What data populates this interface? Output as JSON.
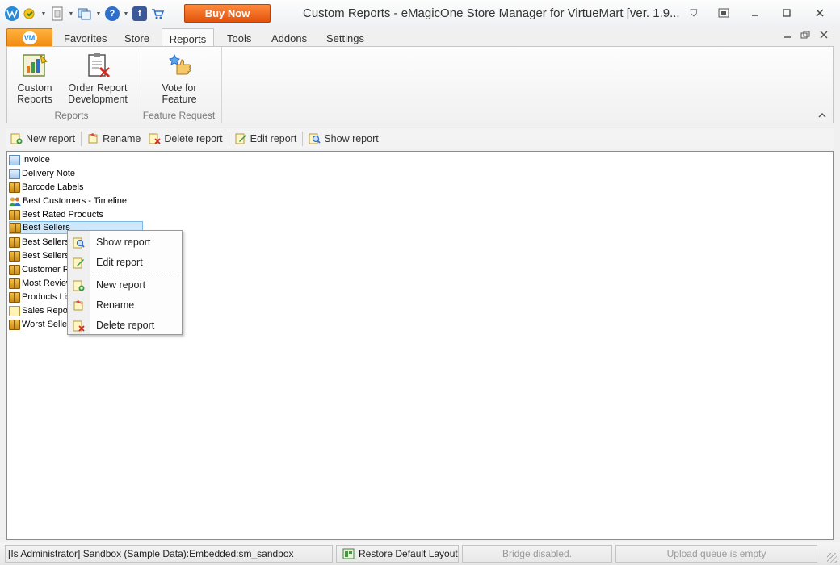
{
  "window": {
    "title": "Custom Reports - eMagicOne Store Manager for VirtueMart [ver. 1.9...",
    "buy_now_label": "Buy Now"
  },
  "ribbon": {
    "app_tab_label": "VM",
    "tabs": [
      "Favorites",
      "Store",
      "Reports",
      "Tools",
      "Addons",
      "Settings"
    ],
    "active_tab": "Reports",
    "groups": [
      {
        "label": "Reports",
        "buttons": [
          {
            "line1": "Custom",
            "line2": "Reports"
          },
          {
            "line1": "Order Report",
            "line2": "Development"
          }
        ]
      },
      {
        "label": "Feature Request",
        "buttons": [
          {
            "line1": "Vote for",
            "line2": "Feature"
          }
        ]
      }
    ]
  },
  "toolbar": {
    "new_report": "New report",
    "rename": "Rename",
    "delete_report": "Delete report",
    "edit_report": "Edit report",
    "show_report": "Show report"
  },
  "reports": [
    {
      "label": "Invoice",
      "icon": "envelope-icon"
    },
    {
      "label": "Delivery Note",
      "icon": "envelope-icon"
    },
    {
      "label": "Barcode Labels",
      "icon": "box-icon"
    },
    {
      "label": "Best Customers - Timeline",
      "icon": "users-icon"
    },
    {
      "label": "Best Rated Products",
      "icon": "box-icon"
    },
    {
      "label": "Best Sellers",
      "icon": "box-icon",
      "selected": true
    },
    {
      "label": "Best Sellers",
      "icon": "box-icon"
    },
    {
      "label": "Best Sellers",
      "icon": "box-icon"
    },
    {
      "label": "Customer R",
      "icon": "box-icon"
    },
    {
      "label": "Most Review",
      "icon": "box-icon"
    },
    {
      "label": "Products Lis",
      "icon": "box-icon"
    },
    {
      "label": "Sales Repor",
      "icon": "note-icon"
    },
    {
      "label": "Worst Seller",
      "icon": "box-icon"
    }
  ],
  "context_menu": {
    "show_report": "Show report",
    "edit_report": "Edit report",
    "new_report": "New report",
    "rename": "Rename",
    "delete_report": "Delete report"
  },
  "status": {
    "connection": "[Is Administrator] Sandbox (Sample Data):Embedded:sm_sandbox",
    "restore_layout": "Restore Default Layout",
    "bridge": "Bridge disabled.",
    "upload_queue": "Upload queue is empty"
  },
  "colors": {
    "buy_now": "#e2520b",
    "app_tab": "#f08a10",
    "selection": "#cde8fb"
  }
}
